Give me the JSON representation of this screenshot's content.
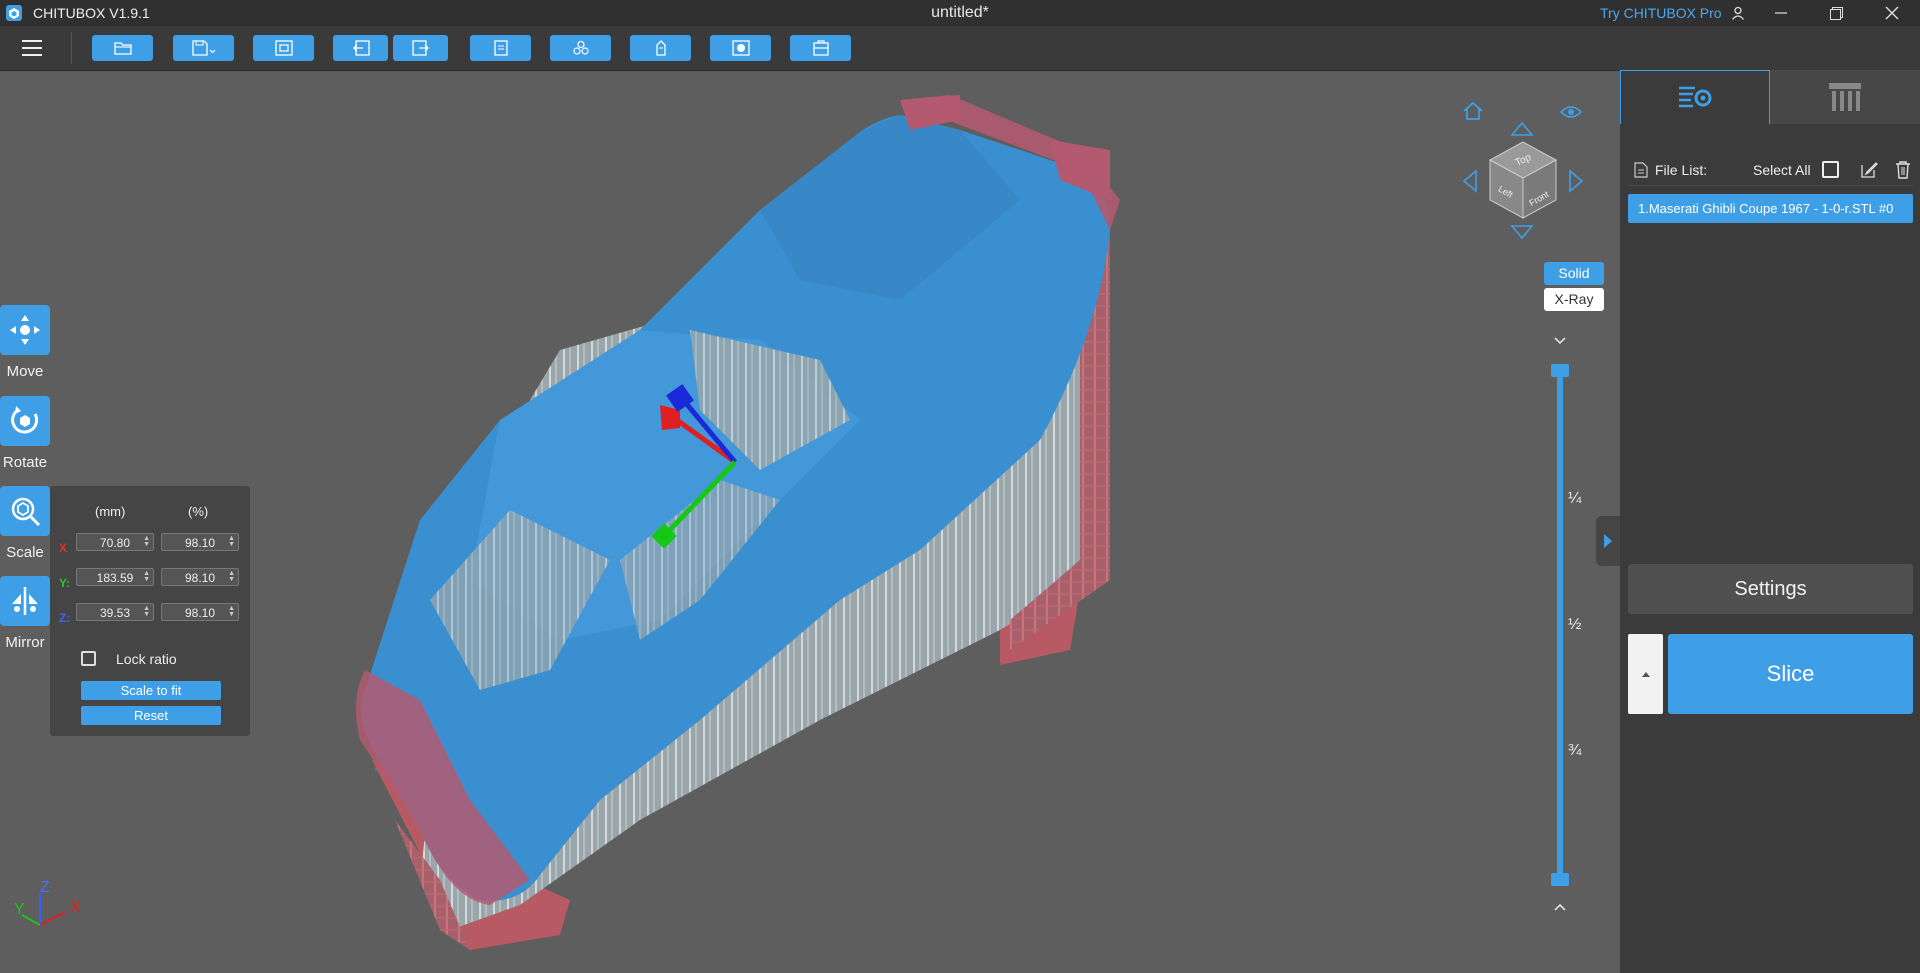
{
  "app": {
    "name": "CHITUBOX V1.9.1",
    "document_title": "untitled*",
    "pro_link": "Try CHITUBOX Pro"
  },
  "toolbar": {
    "buttons": [
      "open-file",
      "save",
      "screenshot",
      "undo",
      "redo",
      "detect",
      "layout",
      "hollow",
      "dig-hole",
      "support"
    ]
  },
  "tools": {
    "move": "Move",
    "rotate": "Rotate",
    "scale": "Scale",
    "mirror": "Mirror"
  },
  "scale_panel": {
    "header_mm": "(mm)",
    "header_pct": "(%)",
    "x_label": "X",
    "y_label": "Y:",
    "z_label": "Z:",
    "x_mm": "70.80",
    "x_pct": "98.10",
    "y_mm": "183.59",
    "y_pct": "98.10",
    "z_mm": "39.53",
    "z_pct": "98.10",
    "lock_ratio": "Lock ratio",
    "lock_checked": false,
    "scale_to_fit": "Scale to fit",
    "reset": "Reset"
  },
  "view": {
    "cube_top": "Top",
    "cube_left": "Left",
    "cube_front": "Front",
    "solid": "Solid",
    "xray": "X-Ray",
    "active_mode": "Solid",
    "layer_marks": [
      "¼",
      "½",
      "¾"
    ],
    "axes": {
      "x": "X",
      "y": "Y",
      "z": "Z"
    }
  },
  "right_panel": {
    "file_list_label": "File List:",
    "select_all": "Select All",
    "files": [
      "1.Maserati Ghibli Coupe 1967 - 1-0-r.STL #0"
    ],
    "settings": "Settings",
    "slice": "Slice"
  },
  "colors": {
    "accent": "#3e9fe6",
    "model": "#3a8fd0",
    "support": "#b8c4c8",
    "raft": "#c05a6a",
    "background": "#5e5e5e"
  }
}
